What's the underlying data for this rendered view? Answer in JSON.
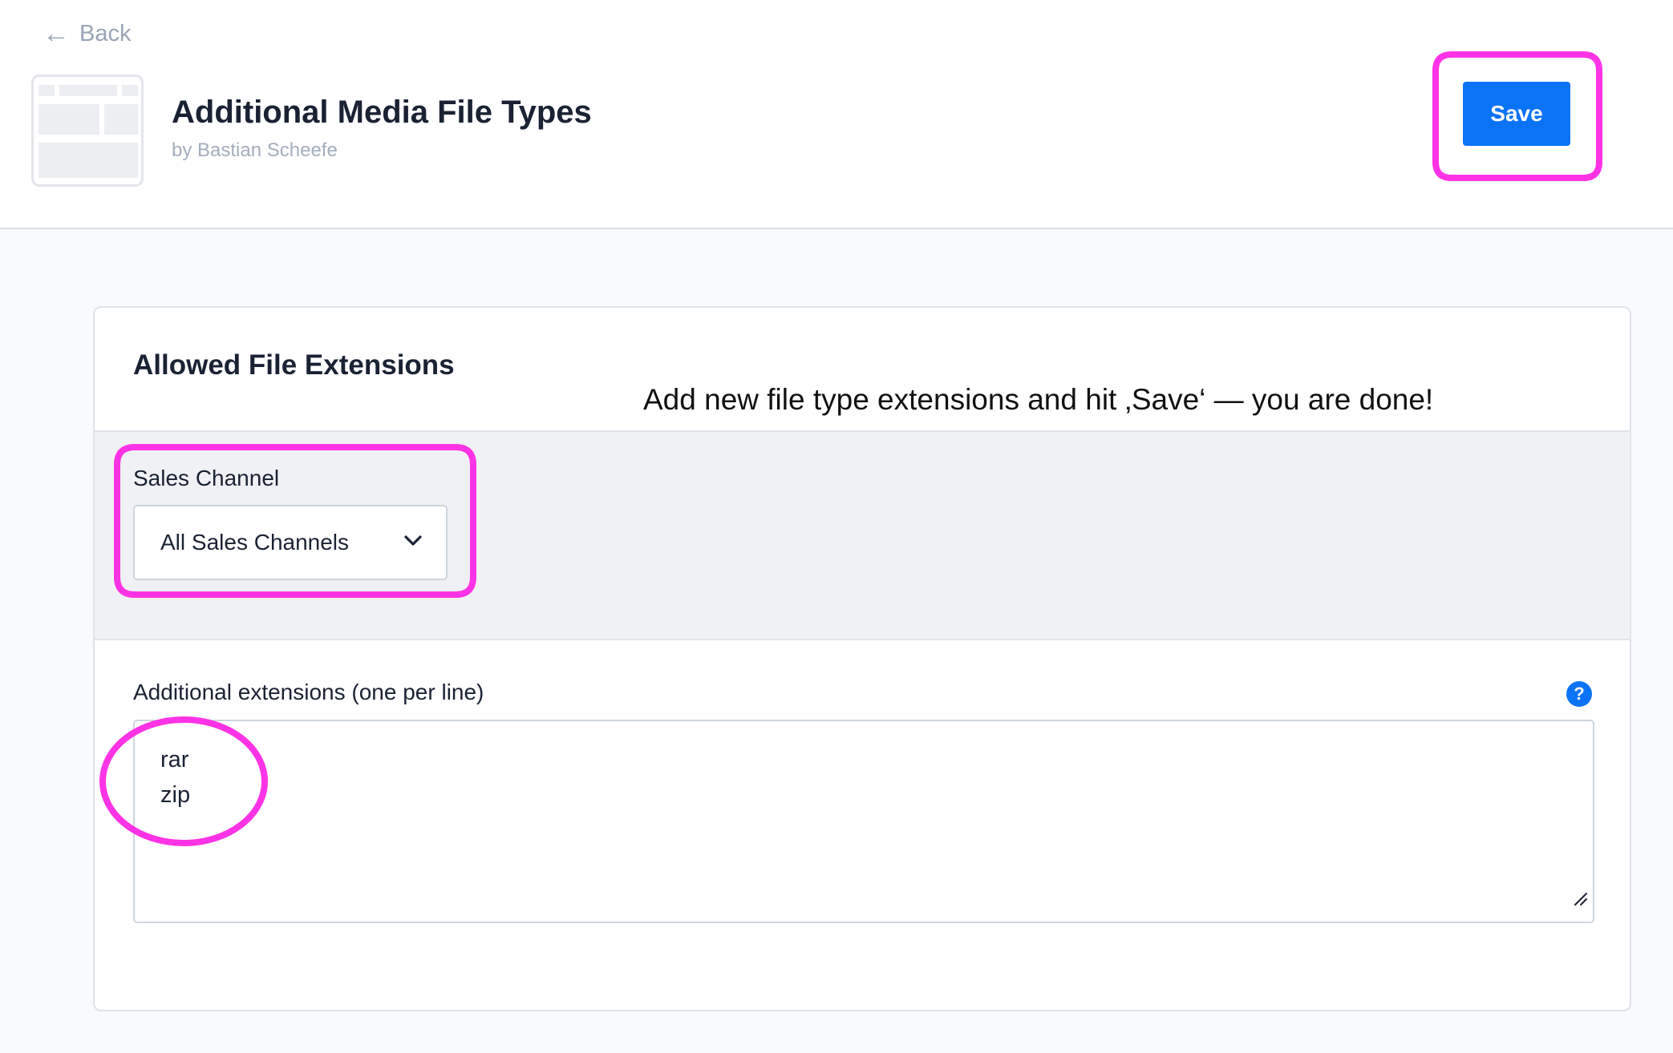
{
  "header": {
    "back_label": "Back",
    "plugin_title": "Additional Media File Types",
    "plugin_author": "by Bastian Scheefe",
    "save_label": "Save"
  },
  "card": {
    "title": "Allowed File Extensions",
    "hint": "Add new file type extensions and hit ‚Save‘ — you are done!",
    "sales_channel": {
      "label": "Sales Channel",
      "selected": "All Sales Channels"
    },
    "extensions": {
      "label": "Additional extensions (one per line)",
      "help": "?",
      "lines": [
        "rar",
        "zip"
      ]
    }
  },
  "colors": {
    "primary": "#0b73f6",
    "annotation": "#ff33e6"
  },
  "icons": [
    "arrow-left-icon",
    "plugin-placeholder-icon",
    "chevron-down-icon",
    "help-icon",
    "resize-grip-icon"
  ]
}
